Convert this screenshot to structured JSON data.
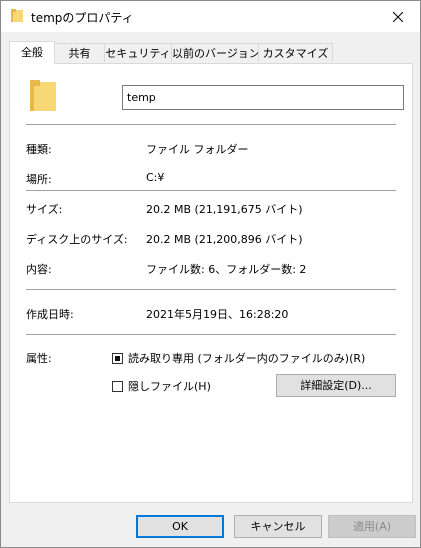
{
  "window": {
    "title": "tempのプロパティ"
  },
  "tabs": [
    {
      "label": "全般",
      "active": true
    },
    {
      "label": "共有",
      "active": false
    },
    {
      "label": "セキュリティ",
      "active": false
    },
    {
      "label": "以前のバージョン",
      "active": false
    },
    {
      "label": "カスタマイズ",
      "active": false
    }
  ],
  "general": {
    "name_value": "temp",
    "rows": {
      "type_label": "種類:",
      "type_value": "ファイル フォルダー",
      "location_label": "場所:",
      "location_value": "C:¥",
      "size_label": "サイズ:",
      "size_value": "20.2 MB (21,191,675 バイト)",
      "disk_size_label": "ディスク上のサイズ:",
      "disk_size_value": "20.2 MB (21,200,896 バイト)",
      "contents_label": "内容:",
      "contents_value": "ファイル数: 6、フォルダー数: 2",
      "created_label": "作成日時:",
      "created_value": "2021年5月19日、16:28:20"
    },
    "attributes": {
      "label": "属性:",
      "readonly_label": "読み取り専用 (フォルダー内のファイルのみ)(R)",
      "readonly_state": "indeterminate",
      "hidden_label": "隠しファイル(H)",
      "hidden_checked": false,
      "advanced_button": "詳細設定(D)..."
    }
  },
  "footer": {
    "ok": "OK",
    "cancel": "キャンセル",
    "apply": "適用(A)"
  },
  "colors": {
    "folder_yellow": "#f8d775",
    "folder_dark": "#e8b84a",
    "accent": "#0078d7"
  }
}
